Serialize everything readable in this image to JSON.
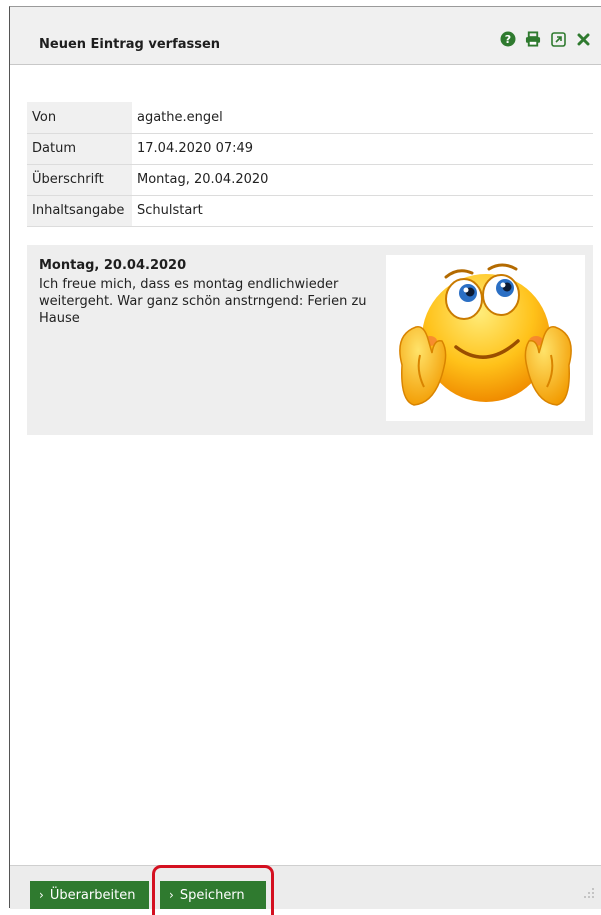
{
  "dialog": {
    "title": "Neuen Eintrag verfassen",
    "icons": [
      "help-icon",
      "print-icon",
      "external-link-icon",
      "close-icon"
    ]
  },
  "meta": {
    "rows": [
      {
        "label": "Von",
        "value": "agathe.engel"
      },
      {
        "label": "Datum",
        "value": "17.04.2020 07:49"
      },
      {
        "label": "Überschrift",
        "value": "Montag, 20.04.2020"
      },
      {
        "label": "Inhaltsangabe",
        "value": "Schulstart"
      }
    ]
  },
  "entry": {
    "title": "Montag, 20.04.2020",
    "text": "Ich freue mich, dass es montag endlichwieder weitergeht. War ganz schön anstrngend: Ferien zu Hause",
    "image": "smiley-emoji"
  },
  "footer": {
    "edit_label": "Überarbeiten",
    "save_label": "Speichern"
  },
  "colors": {
    "button_green": "#2f7a2f",
    "icon_green": "#2f7a2f",
    "highlight_red": "#d41020"
  }
}
